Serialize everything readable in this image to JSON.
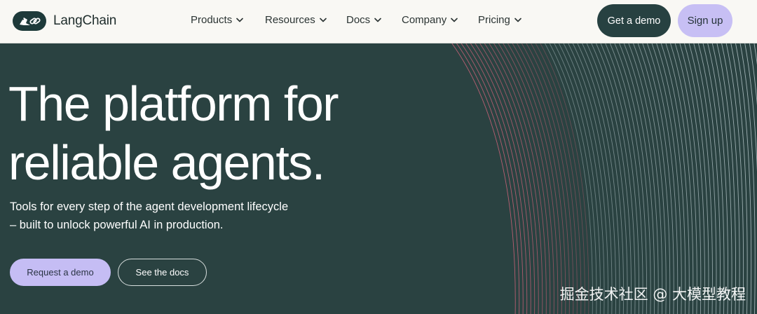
{
  "brand": {
    "name": "LangChain",
    "logo_icon": "parrot-link-icon"
  },
  "nav": {
    "items": [
      {
        "label": "Products",
        "icon": "chevron-down-icon"
      },
      {
        "label": "Resources",
        "icon": "chevron-down-icon"
      },
      {
        "label": "Docs",
        "icon": "chevron-down-icon"
      },
      {
        "label": "Company",
        "icon": "chevron-down-icon"
      },
      {
        "label": "Pricing",
        "icon": "chevron-down-icon"
      }
    ],
    "get_demo_label": "Get a demo",
    "signup_label": "Sign up"
  },
  "hero": {
    "headline_line1": "The platform for",
    "headline_line2": "reliable agents.",
    "subtitle_line1": "Tools for every step of the agent development lifecycle",
    "subtitle_line2": "– built to unlock powerful AI in production.",
    "request_demo_label": "Request a demo",
    "see_docs_label": "See the docs"
  },
  "watermark": "掘金技术社区 @ 大模型教程",
  "colors": {
    "header_bg": "#f9f8f4",
    "hero_bg": "#2a4241",
    "accent_lavender": "#c7bff4",
    "dark_button": "#274141",
    "wave_pink": "#d0637a",
    "wave_light": "#c9d8dc"
  }
}
